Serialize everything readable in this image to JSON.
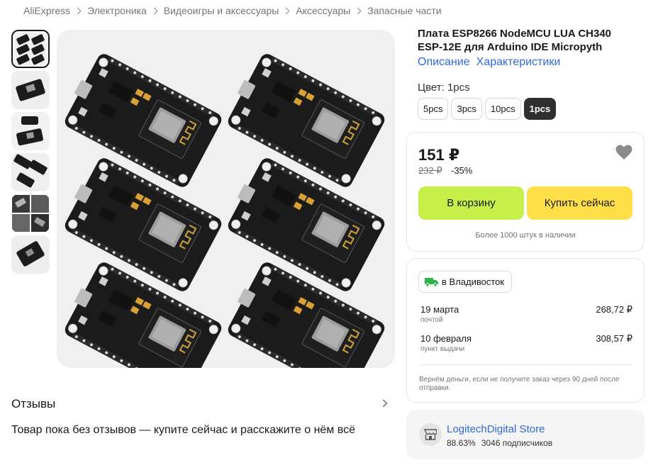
{
  "breadcrumb": [
    "AliExpress",
    "Электроника",
    "Видеоигры и аксессуары",
    "Аксессуары",
    "Запасные части"
  ],
  "gallery": {
    "thumbnails": [
      "thumb-6-boards",
      "thumb-board-top",
      "thumb-board-usb",
      "thumb-boards-angle",
      "thumb-collage",
      "thumb-board-dark"
    ],
    "active_index": 0,
    "main_image": "esp8266-nodemcu-6-boards"
  },
  "product": {
    "title": "Плата ESP8266 NodeMCU LUA CH340 ESP-12E для Arduino IDE Micropyth",
    "links": [
      "Описание",
      "Характеристики"
    ],
    "color_label": "Цвет: 1pcs",
    "options": [
      "5pcs",
      "3pcs",
      "10pcs",
      "1pcs"
    ],
    "selected_option": "1pcs"
  },
  "price": {
    "current": "151 ₽",
    "old": "232 ₽",
    "discount": "-35%",
    "add_to_cart": "В корзину",
    "buy_now": "Купить сейчас",
    "stock": "Более 1000 штук в наличии"
  },
  "delivery": {
    "city": "в Владивосток",
    "options": [
      {
        "date": "19 марта",
        "method": "почтой",
        "price": "268,72 ₽"
      },
      {
        "date": "10 февраля",
        "method": "пункт выдачи",
        "price": "308,57 ₽"
      }
    ],
    "refund_note": "Вернём деньги, если не получите заказ через 90 дней после отправки."
  },
  "store": {
    "name": "LogitechDigital Store",
    "rating": "88.63%",
    "subscribers": "3046 подписчиков"
  },
  "reviews": {
    "title": "Отзывы",
    "empty_text": "Товар пока без отзывов — купите сейчас и расскажите о нём всё"
  },
  "colors": {
    "link": "#2e6ad9",
    "cart_button": "#c6ef4a",
    "buy_button": "#ffdf47",
    "selected_option": "#2f2f2f",
    "delivery_icon": "#2fb24c"
  }
}
